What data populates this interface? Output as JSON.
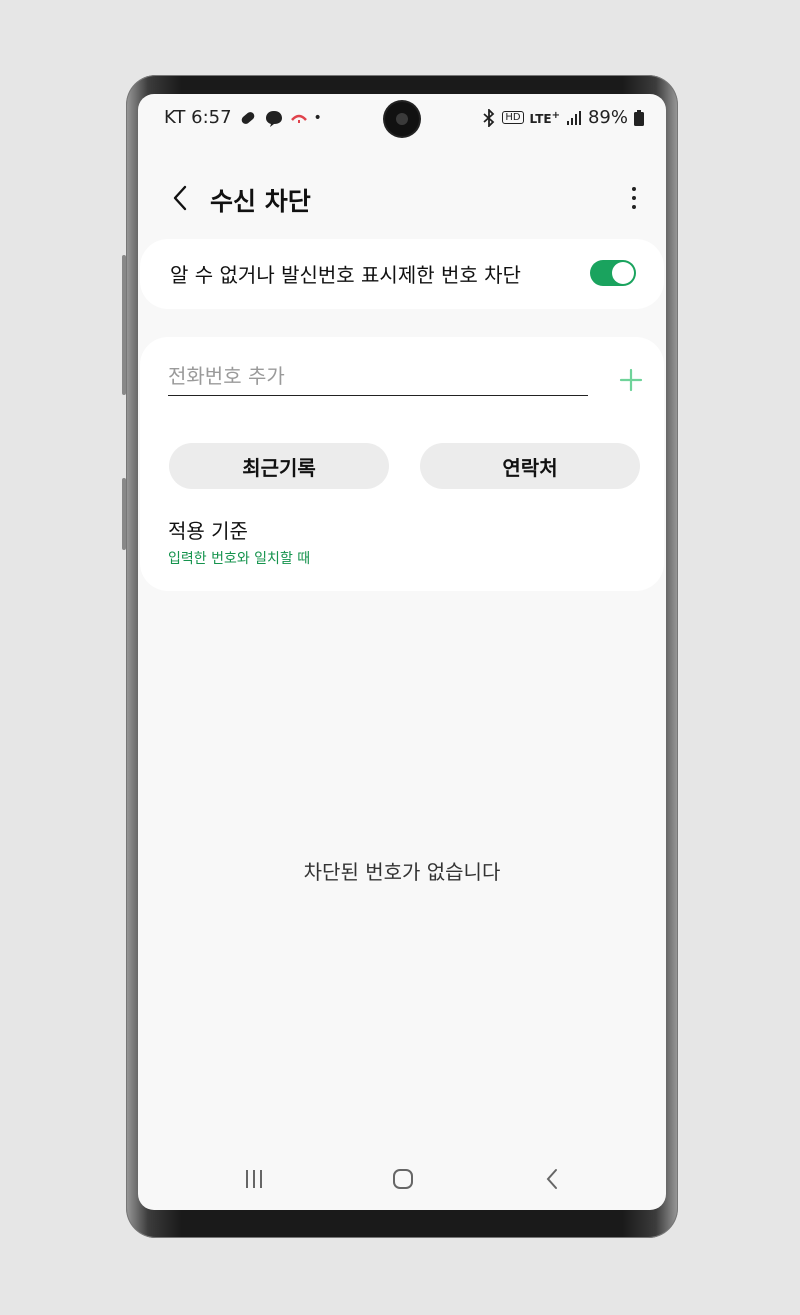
{
  "status_bar": {
    "carrier_time": "KT 6:57",
    "network": "LTE",
    "network_sup": "+",
    "hd_badge": "HD",
    "battery": "89%"
  },
  "app_bar": {
    "title": "수신 차단"
  },
  "unknown_block": {
    "label": "알 수 없거나 발신번호 표시제한 번호 차단",
    "enabled": true
  },
  "add_number": {
    "placeholder": "전화번호 추가"
  },
  "buttons": {
    "recent": "최근기록",
    "contacts": "연락처"
  },
  "criteria": {
    "title": "적용 기준",
    "value": "입력한 번호와 일치할 때"
  },
  "empty_message": "차단된 번호가 없습니다",
  "colors": {
    "accent": "#1aa35e",
    "accent_text": "#15934d",
    "plus_icon": "#6fd39a"
  },
  "icons": [
    "back-arrow-icon",
    "more-vert-icon",
    "plus-icon",
    "recents-icon",
    "home-icon",
    "back-icon",
    "bluetooth-icon",
    "signal-icon",
    "battery-icon"
  ]
}
